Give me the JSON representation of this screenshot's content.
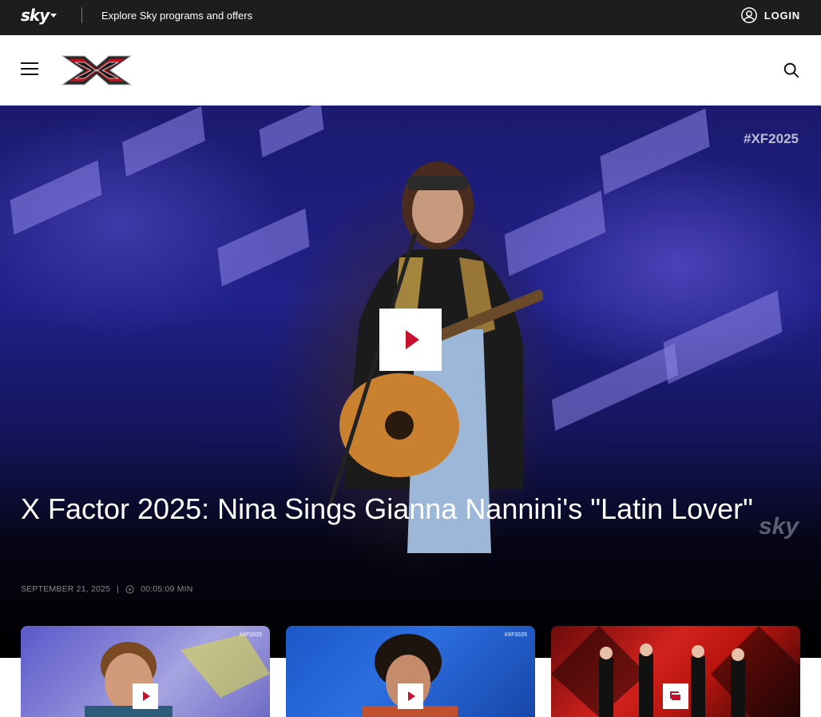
{
  "topbar": {
    "brand": "sky",
    "explore": "Explore Sky programs and offers",
    "login": "LOGIN"
  },
  "header": {
    "logo": "X Factor"
  },
  "hero": {
    "tag": "#XF2025",
    "watermark": "sky",
    "title": "X Factor 2025: Nina Sings Gianna Nannini's \"Latin Lover\"",
    "date": "SEPTEMBER 21, 2025",
    "separator": "|",
    "duration": "00:05:09 MIN"
  },
  "cards": [
    {
      "tag": "#XF2025",
      "kind": "video"
    },
    {
      "tag": "#XF2025",
      "kind": "video"
    },
    {
      "tag": "",
      "kind": "gallery"
    }
  ],
  "icons": {
    "menu": "hamburger-menu-icon",
    "search": "search-icon",
    "login": "user-circle-icon",
    "play": "play-icon",
    "clock": "clock-icon",
    "gallery": "gallery-icon"
  },
  "colors": {
    "topbar": "#1d1d1d",
    "accent": "#c8102e"
  }
}
